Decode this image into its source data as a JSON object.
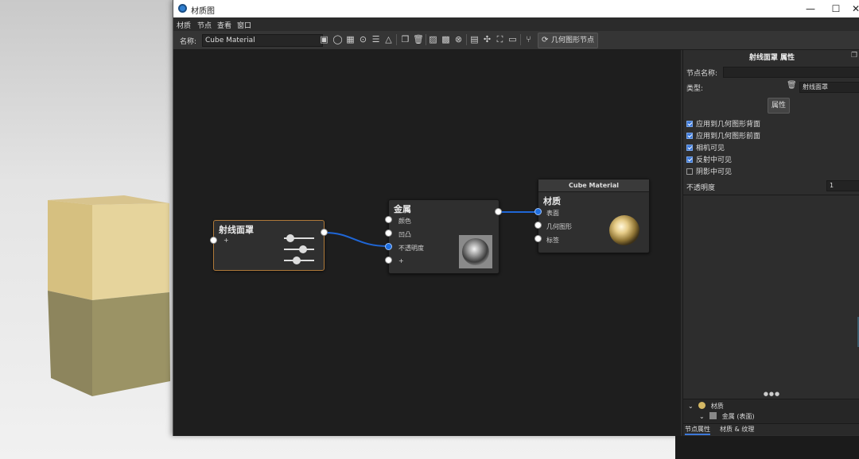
{
  "window": {
    "title": "材质图",
    "minimize_glyph": "—",
    "maximize_glyph": "☐",
    "close_glyph": "✕"
  },
  "menu": [
    "材质",
    "节点",
    "查看",
    "窗口"
  ],
  "toolbar": {
    "name_label": "名称:",
    "name_value": "Cube Material",
    "geometry_node_button": "几何图形节点"
  },
  "nodes": {
    "ray_switch": {
      "title": "射线面罩",
      "add_port": "+"
    },
    "metal": {
      "title": "金属",
      "ports": [
        "颜色",
        "凹凸",
        "不透明度",
        "+"
      ]
    },
    "material": {
      "header": "Cube Material",
      "title": "材质",
      "ports": [
        "表面",
        "几何图形",
        "标签"
      ]
    }
  },
  "panel": {
    "title": "射线面罩 属性",
    "node_name_label": "节点名称:",
    "node_name_value": "",
    "type_label": "类型:",
    "type_value": "射线面罩",
    "properties_button": "属性",
    "checkboxes": [
      {
        "label": "应用到几何图形背面",
        "checked": true
      },
      {
        "label": "应用到几何图形前面",
        "checked": true
      },
      {
        "label": "相机可见",
        "checked": true
      },
      {
        "label": "反射中可见",
        "checked": true
      },
      {
        "label": "阴影中可见",
        "checked": false
      }
    ],
    "opacity_label": "不透明度",
    "opacity_value": "1",
    "more_glyph": "●●●",
    "tree": [
      {
        "label": "材质"
      },
      {
        "label": "金属 (表面)"
      }
    ],
    "tabs": [
      "节点属性",
      "材质 & 纹理"
    ]
  }
}
